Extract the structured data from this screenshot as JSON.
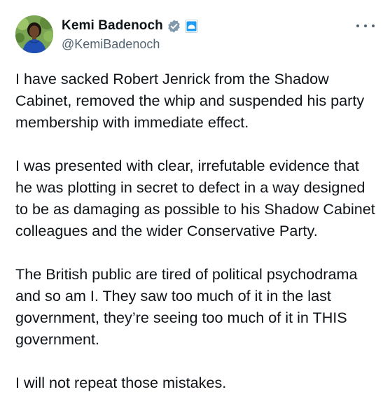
{
  "author": {
    "display_name": "Kemi Badenoch",
    "handle": "@KemiBadenoch",
    "verified_icon": "verified-badge-icon",
    "affiliation_icon": "affiliation-badge-icon",
    "avatar_icon": "avatar"
  },
  "menu": {
    "more_icon": "more-options-icon"
  },
  "tweet": {
    "paragraphs": [
      "I have sacked Robert Jenrick from the Shadow Cabinet, removed the whip and suspended his party membership with immediate effect.",
      "I was presented with clear, irrefutable evidence that he was plotting in secret to defect in a way designed to be as damaging as possible to his Shadow Cabinet colleagues and the wider Conservative Party.",
      "The British public are tired of political psychodrama and so am I. They saw too much of it in the last government, they’re seeing too much of it in THIS government.",
      "I will not repeat those mistakes."
    ]
  },
  "colors": {
    "text": "#0f1419",
    "secondary": "#536471",
    "verified": "#829aab",
    "affiliation": "#1d9bf0"
  }
}
